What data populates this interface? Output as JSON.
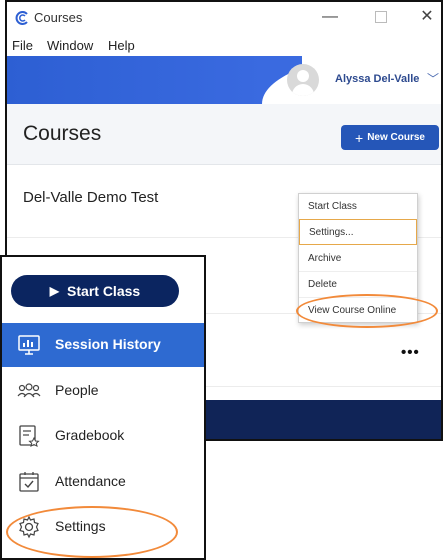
{
  "window": {
    "title": "Courses",
    "menu": [
      "File",
      "Window",
      "Help"
    ]
  },
  "user": {
    "name": "Alyssa Del-Valle"
  },
  "page": {
    "title": "Courses",
    "new_course_label": "New Course"
  },
  "courses": [
    {
      "name": "Del-Valle Demo Test"
    }
  ],
  "context_menu": {
    "items": [
      "Start Class",
      "Settings...",
      "Archive",
      "Delete",
      "View Course Online"
    ]
  },
  "more_label": "•••",
  "sidebar": {
    "start_class_label": "Start Class",
    "items": [
      {
        "label": "Session History",
        "icon": "session-history-icon",
        "active": true
      },
      {
        "label": "People",
        "icon": "people-icon"
      },
      {
        "label": "Gradebook",
        "icon": "gradebook-icon"
      },
      {
        "label": "Attendance",
        "icon": "attendance-icon"
      },
      {
        "label": "Settings",
        "icon": "gear-icon"
      }
    ]
  },
  "colors": {
    "brand_blue": "#2d5fd3",
    "navy": "#0b2560",
    "highlight_ring": "#f28a3a",
    "active_nav": "#2e6ad1"
  }
}
